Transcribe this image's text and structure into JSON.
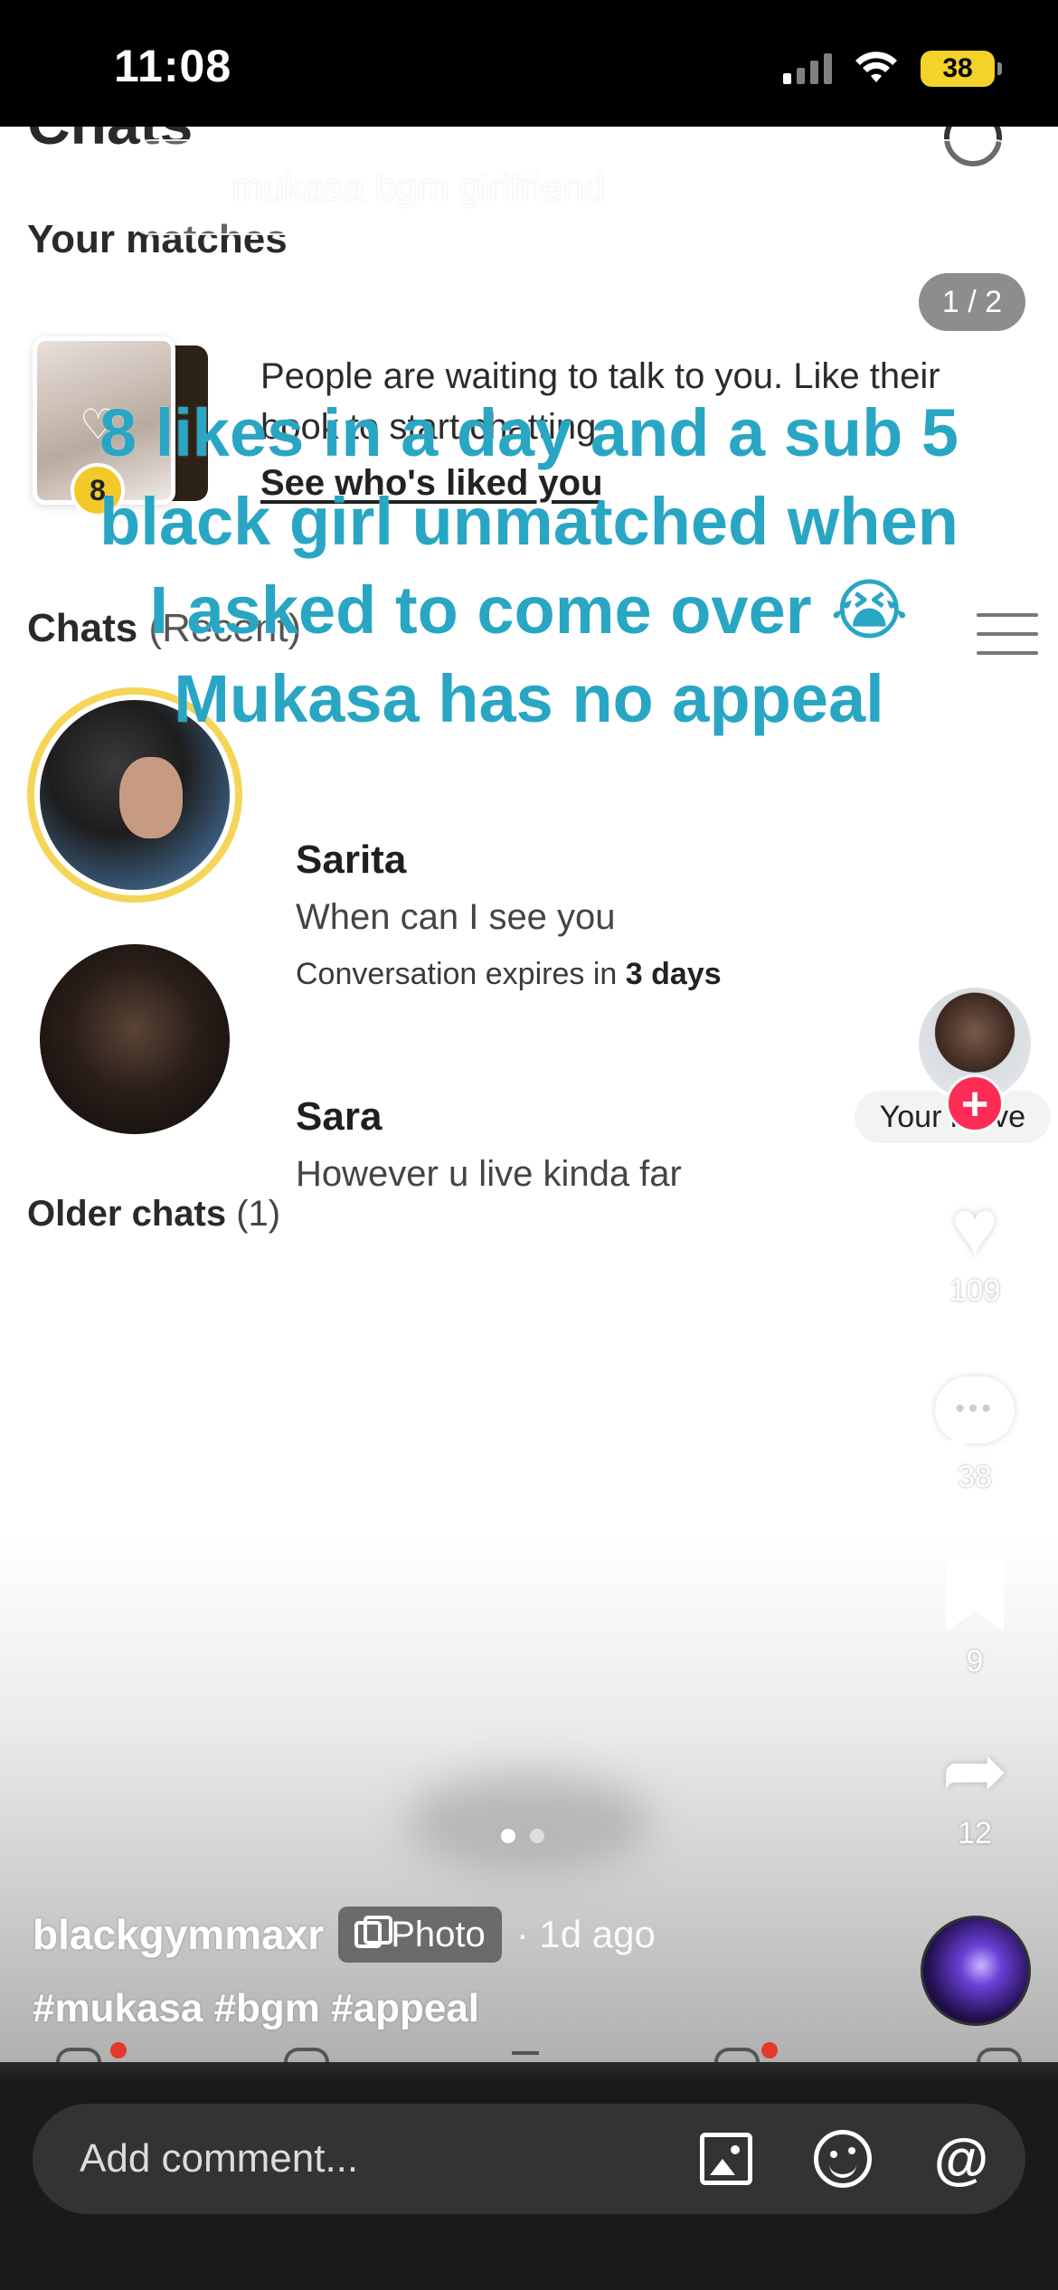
{
  "status_bar": {
    "time": "11:08",
    "battery": "38",
    "icons": [
      "cellular-signal-icon",
      "wifi-icon",
      "battery-icon"
    ]
  },
  "app": {
    "title": "Chats",
    "matches_heading": "Your matches",
    "pager": "1 / 2",
    "like_count": "8",
    "likes_prompt": "People are waiting to talk to you. Like their book to start chatting.",
    "likes_link": "See who's liked you",
    "chats_heading": "Chats",
    "chats_heading_sub": "(Recent)",
    "chats": [
      {
        "name": "Sarita",
        "message": "When can I see you",
        "expiry_prefix": "Conversation expires in",
        "expiry_value": "3 days"
      },
      {
        "name": "Sara",
        "message": "However u live kinda far",
        "badge": "Your move"
      }
    ],
    "older_heading": "Older chats",
    "older_count": "(1)"
  },
  "overlay": {
    "caption": "8 likes in a day and a sub 5\nblack girl unmatched when\nI asked to come over 😭\nMukasa has no appeal"
  },
  "tiktok": {
    "search_query": "mukasa bgm girlfriend",
    "search_button": "Search",
    "counts": {
      "likes": "109",
      "comments": "38",
      "saves": "9",
      "shares": "12"
    },
    "carousel": {
      "total": 2,
      "active": 1
    },
    "username": "blackgymmaxr",
    "type_badge": "Photo",
    "post_time": "· 1d ago",
    "hashtags": "#mukasa #bgm #appeal",
    "comment_placeholder": "Add comment...",
    "accent": "#fe2c55"
  },
  "colors": {
    "caption": "#29a6c4",
    "ring": "#f5d557",
    "status_bar": "#000000",
    "comment_bar": "#333333"
  }
}
